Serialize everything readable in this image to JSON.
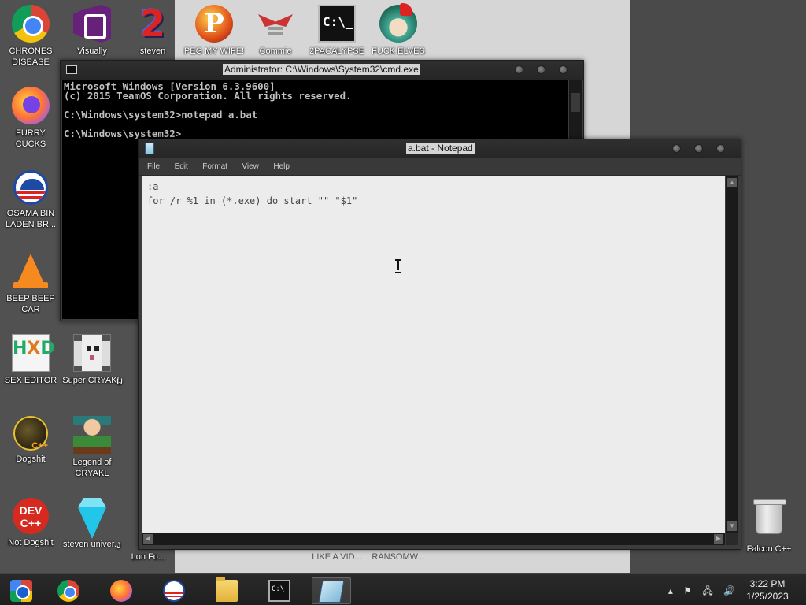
{
  "desktop": {
    "icons_top": [
      {
        "label": "CHRONES DISEASE",
        "icon": "chrome-icon"
      },
      {
        "label": "Visually",
        "icon": "visual-studio-icon"
      },
      {
        "label": "steven",
        "icon": "number-two-icon"
      },
      {
        "label": "PEG MY WIFE!",
        "icon": "peggle-icon"
      },
      {
        "label": "Commie",
        "icon": "eagle-emblem-icon"
      },
      {
        "label": "2PACALYPSE",
        "icon": "command-prompt-icon"
      },
      {
        "label": "FUCK ELVES",
        "icon": "elf-icon"
      }
    ],
    "icons_left": [
      {
        "label": "FURRY CUCKS",
        "icon": "firefox-icon"
      },
      {
        "label": "OSAMA BIN LADEN BR...",
        "icon": "obama-logo-icon"
      },
      {
        "label": "BEEP BEEP CAR",
        "icon": "vlc-cone-icon"
      },
      {
        "label": "SEX EDITOR",
        "icon": "hxd-icon"
      },
      {
        "label": "Super CRYAKL",
        "icon": "pixel-dog-icon"
      },
      {
        "label": "Dogshit",
        "icon": "dogshit-cpp-icon"
      },
      {
        "label": "Legend of CRYAKL",
        "icon": "pixel-hero-icon"
      },
      {
        "label": "Not Dogshit",
        "icon": "dev-cpp-icon"
      },
      {
        "label": "steven univer...",
        "icon": "diamond-icon"
      }
    ],
    "partial_labels": [
      "U",
      "J",
      "Lon Fo...",
      "LIKE A VID...",
      "RANSOMW...",
      "C"
    ],
    "recycle_bin": {
      "label": "Falcon C++",
      "icon": "recycle-bin-icon"
    }
  },
  "cmd_window": {
    "title": "Administrator: C:\\Windows\\System32\\cmd.exe",
    "lines": [
      "Microsoft Windows [Version 6.3.9600]",
      "(c) 2015 TeamOS Corporation. All rights reserved.",
      "",
      "C:\\Windows\\system32>notepad a.bat",
      "",
      "C:\\Windows\\system32>"
    ]
  },
  "notepad_window": {
    "title": "a.bat - Notepad",
    "menu": [
      "File",
      "Edit",
      "Format",
      "View",
      "Help"
    ],
    "lines": [
      ":a",
      "for /r %1 in (*.exe) do start \"\" \"$1\""
    ]
  },
  "taskbar": {
    "items": [
      {
        "name": "start-button",
        "icon": "start-orb-icon"
      },
      {
        "name": "chrome-task",
        "icon": "chrome-icon"
      },
      {
        "name": "firefox-task",
        "icon": "firefox-icon"
      },
      {
        "name": "obama-task",
        "icon": "obama-logo-icon"
      },
      {
        "name": "explorer-task",
        "icon": "folder-icon"
      },
      {
        "name": "cmd-task",
        "icon": "command-prompt-icon"
      },
      {
        "name": "notepad-task",
        "icon": "notepad-icon",
        "active": true
      }
    ],
    "tray": {
      "chevron": "▴",
      "flag": "⚑",
      "network": "🖧",
      "volume": "🔊"
    },
    "clock": {
      "time": "3:22 PM",
      "date": "1/25/2023"
    }
  }
}
